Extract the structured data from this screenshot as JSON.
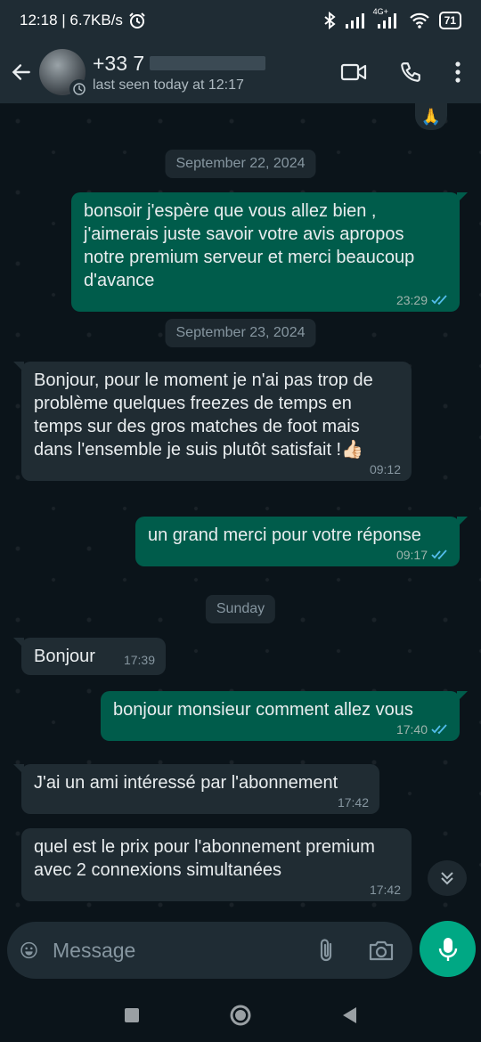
{
  "status_bar": {
    "time_speed": "12:18 | 6.7KB/s",
    "network_label": "4G+",
    "battery": "71"
  },
  "header": {
    "contact_name": "+33 7",
    "last_seen": "last seen today at 12:17"
  },
  "reaction": "🙏",
  "messages": [
    {
      "type": "date",
      "text": "September 22, 2024"
    },
    {
      "type": "out",
      "text": "bonsoir j'espère que vous allez bien , j'aimerais juste savoir votre avis apropos notre premium serveur et merci beaucoup d'avance",
      "time": "23:29",
      "read": true
    },
    {
      "type": "date",
      "text": "September 23, 2024"
    },
    {
      "type": "in",
      "text": "Bonjour, pour le moment je n'ai pas trop de problème quelques freezes de temps en temps sur des gros matches de foot mais dans l'ensemble je suis plutôt satisfait !👍🏻",
      "time": "09:12"
    },
    {
      "type": "out",
      "text": "un grand merci pour votre réponse",
      "time": "09:17",
      "read": true
    },
    {
      "type": "date",
      "text": "Sunday"
    },
    {
      "type": "in",
      "text": "Bonjour",
      "time": "17:39"
    },
    {
      "type": "out",
      "text": "bonjour monsieur comment allez vous",
      "time": "17:40",
      "read": true
    },
    {
      "type": "in",
      "text": "J'ai un ami intéressé par l'abonnement",
      "time": "17:42"
    },
    {
      "type": "in",
      "text": "quel est le prix pour l'abonnement premium avec 2 connexions simultanées",
      "time": "17:42"
    }
  ],
  "composer": {
    "placeholder": "Message"
  },
  "colors": {
    "background": "#0b141a",
    "header": "#1f2c34",
    "incoming": "#202c33",
    "outgoing": "#005c4b",
    "accent": "#00a884",
    "read_ticks": "#53bdeb"
  },
  "icons": {
    "back": "arrow-left-icon",
    "video": "video-camera-icon",
    "call": "phone-icon",
    "menu": "more-vertical-icon",
    "emoji": "emoji-icon",
    "attach": "paperclip-icon",
    "camera": "camera-icon",
    "mic": "microphone-icon",
    "scroll": "chevron-double-down-icon"
  }
}
